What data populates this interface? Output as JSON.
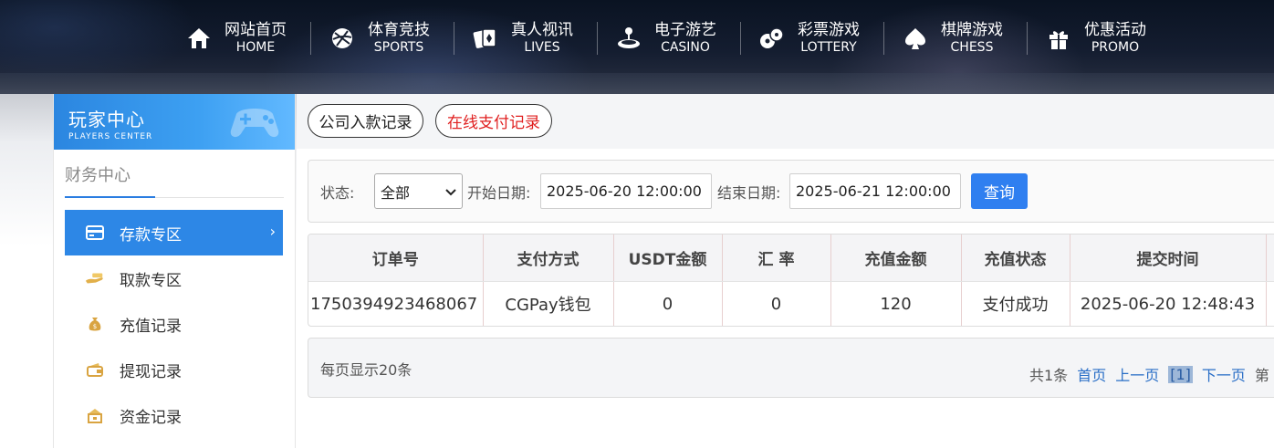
{
  "nav": [
    {
      "cn": "网站首页",
      "en": "HOME",
      "icon": "home-icon"
    },
    {
      "cn": "体育竞技",
      "en": "SPORTS",
      "icon": "ball-icon"
    },
    {
      "cn": "真人视讯",
      "en": "LIVES",
      "icon": "cards-icon"
    },
    {
      "cn": "电子游艺",
      "en": "CASINO",
      "icon": "joystick-icon"
    },
    {
      "cn": "彩票游戏",
      "en": "LOTTERY",
      "icon": "lottery-balls-icon"
    },
    {
      "cn": "棋牌游戏",
      "en": "CHESS",
      "icon": "spade-icon"
    },
    {
      "cn": "优惠活动",
      "en": "PROMO",
      "icon": "gift-icon"
    }
  ],
  "sidebar": {
    "header_cn": "玩家中心",
    "header_en": "PLAYERS CENTER",
    "section_title": "财务中心",
    "items": [
      {
        "label": "存款专区",
        "icon": "card-icon",
        "active": true
      },
      {
        "label": "取款专区",
        "icon": "cash-hand-icon"
      },
      {
        "label": "充值记录",
        "icon": "money-bag-icon"
      },
      {
        "label": "提现记录",
        "icon": "wallet-icon"
      },
      {
        "label": "资金记录",
        "icon": "safe-icon"
      }
    ]
  },
  "tabs": {
    "company_deposit": "公司入款记录",
    "online_payment": "在线支付记录"
  },
  "filter": {
    "status_label": "状态:",
    "status_value": "全部",
    "start_label": "开始日期:",
    "start_value": "2025-06-20 12:00:00",
    "end_label": "结束日期:",
    "end_value": "2025-06-21 12:00:00",
    "query_label": "查询"
  },
  "table": {
    "headers": [
      "订单号",
      "支付方式",
      "USDT金额",
      "汇 率",
      "充值金额",
      "充值状态",
      "提交时间"
    ],
    "rows": [
      [
        "1750394923468067",
        "CGPay钱包",
        "0",
        "0",
        "120",
        "支付成功",
        "2025-06-20 12:48:43"
      ]
    ]
  },
  "pager": {
    "per_page": "每页显示20条",
    "total": "共1条",
    "first": "首页",
    "prev": "上一页",
    "current": "[1]",
    "next": "下一页",
    "tail": "第"
  },
  "colors": {
    "accent": "#2d87e6",
    "online_tab": "#e02020",
    "query_button": "#2f7ff0"
  }
}
